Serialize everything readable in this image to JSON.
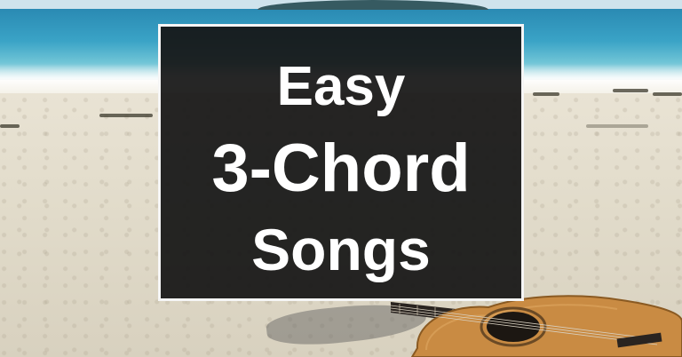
{
  "title": {
    "line1": "Easy",
    "line2": "3-Chord",
    "line3": "Songs"
  },
  "colors": {
    "panel_background": "#161616",
    "panel_border": "#f5f5f5",
    "text": "#ffffff",
    "sea": "#2a8ab3",
    "sand": "#e2dccb",
    "guitar_body": "#c98b43"
  }
}
